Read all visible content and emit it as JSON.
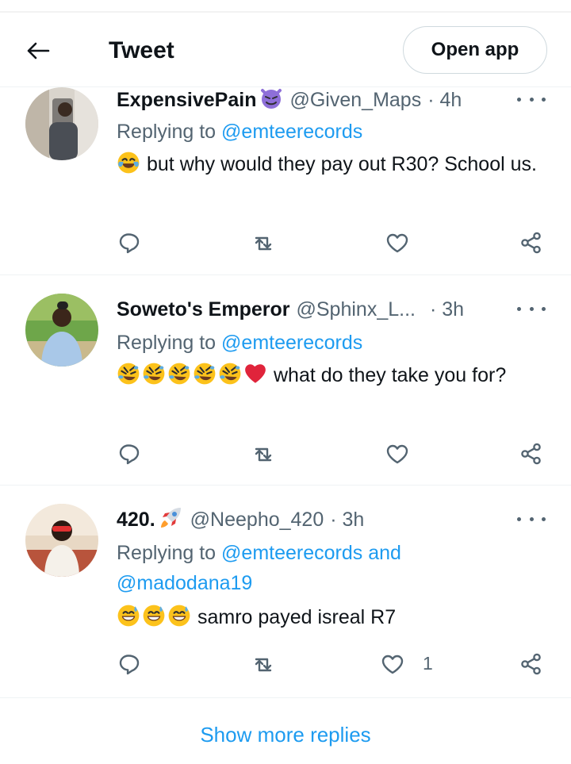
{
  "header": {
    "title": "Tweet",
    "open_app_label": "Open app"
  },
  "tweets": [
    {
      "name": "ExpensivePain",
      "handle": "@Given_Maps",
      "time": "· 4h",
      "replying_prefix": "Replying to ",
      "replying_to": "@emteerecords",
      "replying_to_2": "",
      "text": "but why would they pay out R30? School us.",
      "likes": ""
    },
    {
      "name": "Soweto's Emperor",
      "handle": "@Sphinx_L...",
      "time": "· 3h",
      "replying_prefix": "Replying to ",
      "replying_to": "@emteerecords",
      "replying_to_2": "",
      "text": "what do they take you for?",
      "likes": ""
    },
    {
      "name": "420.",
      "handle": "@Neepho_420",
      "time": "· 3h",
      "replying_prefix": "Replying to ",
      "replying_to": "@emteerecords and",
      "replying_to_2": "@madodana19",
      "text": "samro payed isreal R7",
      "likes": "1"
    }
  ],
  "show_more_label": "Show more replies",
  "colors": {
    "accent": "#1d9bf0",
    "muted": "#536471",
    "text": "#0f1419",
    "divider": "#eff3f4"
  },
  "icons": [
    "back-arrow-icon",
    "more-icon",
    "reply-icon",
    "retweet-icon",
    "like-icon",
    "share-icon",
    "devil-emoji-icon",
    "joy-emoji-icon",
    "rofl-emoji-icon",
    "broken-heart-emoji-icon",
    "rocket-emoji-icon",
    "sweat-smile-emoji-icon"
  ]
}
